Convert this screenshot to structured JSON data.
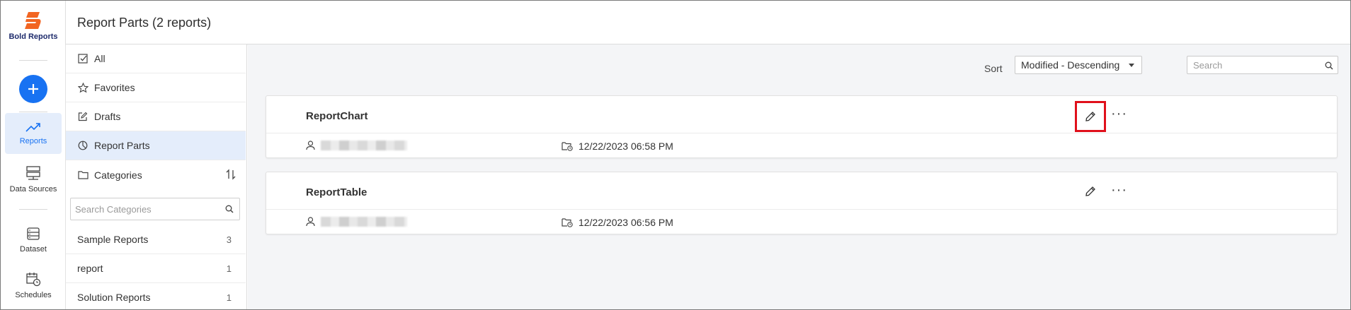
{
  "app": {
    "brand": "Bold Reports",
    "brand_color": "#f26522",
    "accent": "#1872f2"
  },
  "rail": {
    "items": [
      {
        "label": "Reports",
        "icon": "trending-up-icon",
        "active": true
      },
      {
        "label": "Data Sources",
        "icon": "server-icon",
        "active": false
      },
      {
        "label": "Dataset",
        "icon": "dataset-icon",
        "active": false
      },
      {
        "label": "Schedules",
        "icon": "calendar-clock-icon",
        "active": false
      }
    ],
    "add_icon": "plus-icon"
  },
  "header": {
    "title": "Report Parts (2 reports)"
  },
  "sidebar": {
    "items": [
      {
        "label": "All",
        "icon": "checkbox-icon"
      },
      {
        "label": "Favorites",
        "icon": "star-icon"
      },
      {
        "label": "Drafts",
        "icon": "edit-square-icon"
      },
      {
        "label": "Report Parts",
        "icon": "pie-chart-icon",
        "active": true
      },
      {
        "label": "Categories",
        "icon": "folder-icon"
      }
    ],
    "category_search_placeholder": "Search Categories",
    "categories": [
      {
        "name": "Sample Reports",
        "count": "3"
      },
      {
        "name": "report",
        "count": "1"
      },
      {
        "name": "Solution Reports",
        "count": "1"
      }
    ]
  },
  "toolbar": {
    "sort_label": "Sort",
    "sort_value": "Modified - Descending",
    "search_placeholder": "Search"
  },
  "reports": [
    {
      "name": "ReportChart",
      "modified": "12/22/2023 06:58 PM",
      "edit_highlighted": true
    },
    {
      "name": "ReportTable",
      "modified": "12/22/2023 06:56 PM",
      "edit_highlighted": false
    }
  ]
}
